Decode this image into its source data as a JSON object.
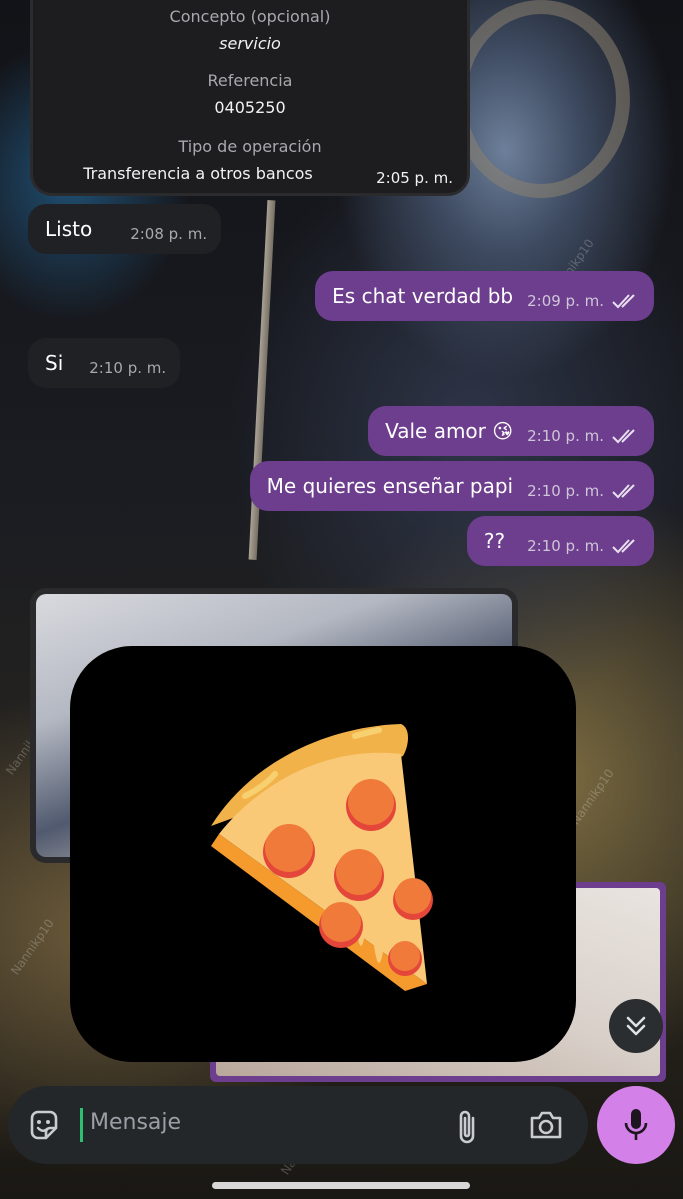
{
  "transfer": {
    "concepto_label": "Concepto (opcional)",
    "concepto_value": "servicio",
    "referencia_label": "Referencia",
    "referencia_value": "0405250",
    "tipo_label": "Tipo de operación",
    "tipo_value": "Transferencia a otros bancos",
    "time": "2:05 p. m."
  },
  "messages": [
    {
      "text": "Listo",
      "time": "2:08 p. m."
    },
    {
      "text": "Es chat verdad bb",
      "time": "2:09 p. m."
    },
    {
      "text": "Si",
      "time": "2:10 p. m."
    },
    {
      "text": "Vale amor 😘",
      "time": "2:10 p. m."
    },
    {
      "text": "Me quieres enseñar papi",
      "time": "2:10 p. m."
    },
    {
      "text": "??",
      "time": "2:10 p. m."
    }
  ],
  "sticker": {
    "icon": "pizza-slice-icon"
  },
  "input": {
    "placeholder": "Mensaje"
  },
  "watermark": "Nannikp10",
  "colors": {
    "outgoing": "#6d3d8e",
    "incoming": "#1f2124",
    "mic": "#d381e8"
  }
}
